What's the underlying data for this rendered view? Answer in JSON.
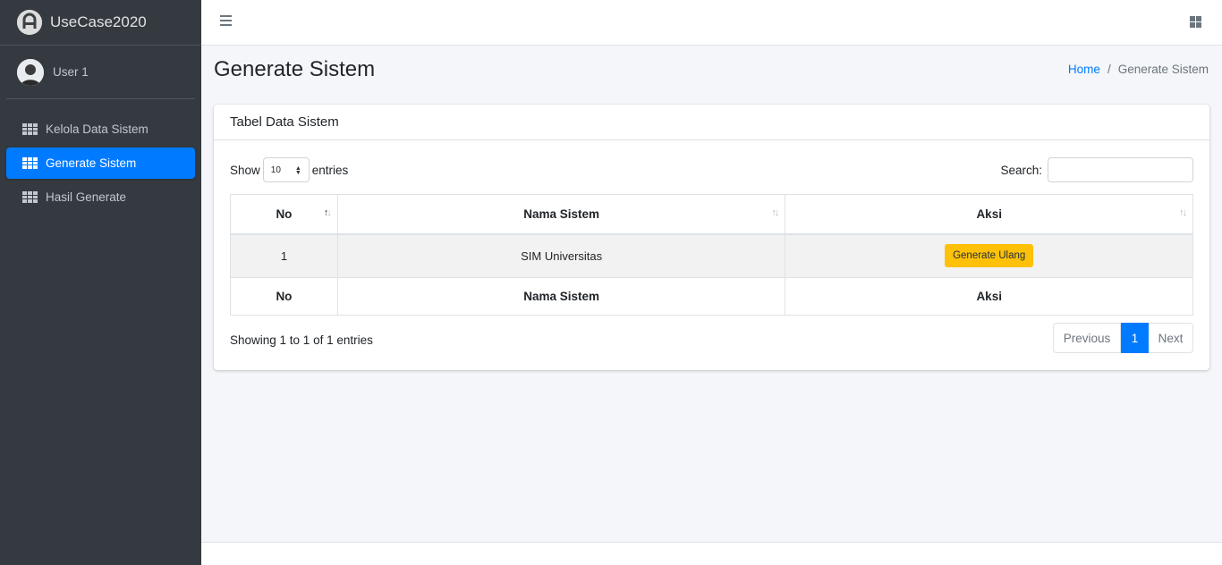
{
  "app": {
    "brand": "UseCase2020"
  },
  "user": {
    "name": "User 1"
  },
  "sidebar": {
    "items": [
      {
        "label": "Kelola Data Sistem",
        "active": false
      },
      {
        "label": "Generate Sistem",
        "active": true
      },
      {
        "label": "Hasil Generate",
        "active": false
      }
    ]
  },
  "header": {
    "title": "Generate Sistem"
  },
  "breadcrumb": {
    "home": "Home",
    "current": "Generate Sistem"
  },
  "card": {
    "title": "Tabel Data Sistem",
    "show_label": "Show",
    "entries_label": "entries",
    "page_size": "10",
    "search_label": "Search:",
    "search_value": "",
    "columns": [
      "No",
      "Nama Sistem",
      "Aksi"
    ],
    "rows": [
      {
        "no": "1",
        "nama": "SIM Universitas",
        "action": "Generate Ulang"
      }
    ],
    "info": "Showing 1 to 1 of 1 entries",
    "pagination": {
      "previous": "Previous",
      "current": "1",
      "next": "Next"
    }
  },
  "colors": {
    "primary": "#007bff",
    "warning": "#ffc107",
    "sidebar": "#343a40"
  }
}
